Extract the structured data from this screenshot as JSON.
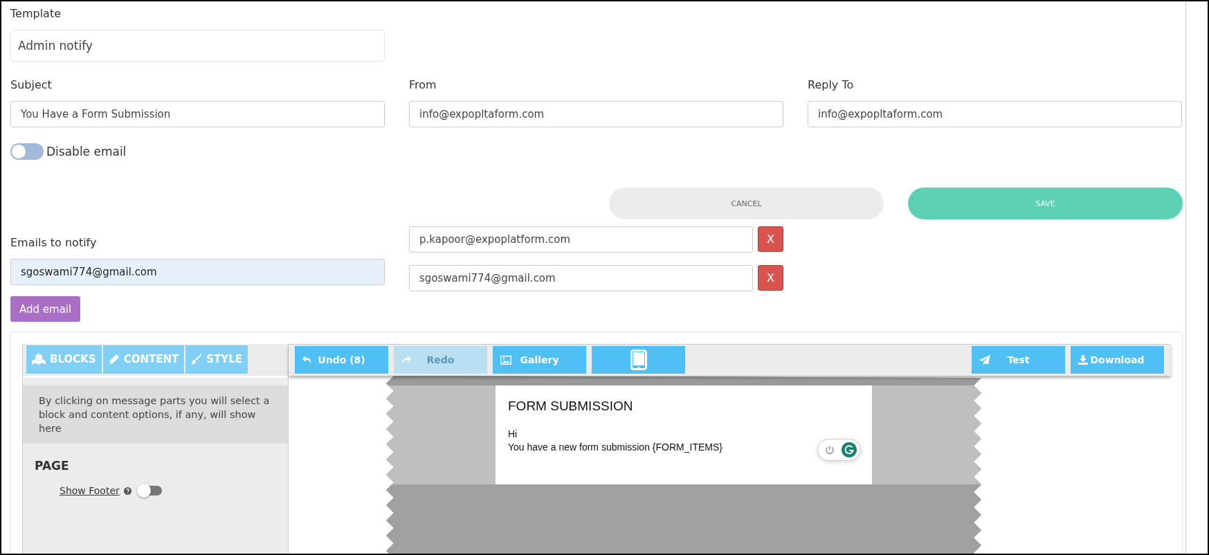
{
  "template": {
    "label": "Template",
    "value": "Admin notify"
  },
  "fields": [
    {
      "label": "Subject",
      "value": "You Have a Form Submission"
    },
    {
      "label": "From",
      "value": "info@expopltaform.com"
    },
    {
      "label": "Reply To",
      "value": "info@expopltaform.com"
    }
  ],
  "disable_email": {
    "label": "Disable email",
    "on": false
  },
  "buttons": [
    {
      "label": "CANCEL",
      "kind": "cancel"
    },
    {
      "label": "SAVE",
      "kind": "save"
    }
  ],
  "emails": {
    "label": "Emails to notify",
    "value": "sgoswami774@gmail.com",
    "add_button": "Add email",
    "list": [
      {
        "value": "p.kapoor@expoplatform.com",
        "remove": "X"
      },
      {
        "value": "sgoswami774@gmail.com",
        "remove": "X"
      }
    ]
  },
  "editor": {
    "tabs": [
      {
        "label": "BLOCKS",
        "kind": "blocks",
        "selected": false
      },
      {
        "label": "CONTENT",
        "kind": "content",
        "selected": false
      },
      {
        "label": "STYLE",
        "kind": "style",
        "selected": false
      }
    ],
    "toolbar_left": [
      {
        "label": "Undo (8)",
        "kind": "undo",
        "disabled": false
      },
      {
        "label": "Redo",
        "kind": "redo",
        "disabled": true
      },
      {
        "label": "Gallery",
        "kind": "gallery",
        "disabled": false
      },
      {
        "kind": "tablet",
        "disabled": false
      }
    ],
    "toolbar_right": [
      {
        "label": "Test",
        "kind": "send",
        "disabled": false
      },
      {
        "label": "Download",
        "kind": "download",
        "disabled": false
      }
    ],
    "hint": "By clicking on message parts you will select a block and content options, if any, will show here",
    "section": "PAGE",
    "show_footer": {
      "label": "Show Footer",
      "on": false
    },
    "message": {
      "title": "FORM SUBMISSION",
      "lines": [
        "Hi",
        "You have a new form submission {FORM_ITEMS}"
      ]
    }
  }
}
